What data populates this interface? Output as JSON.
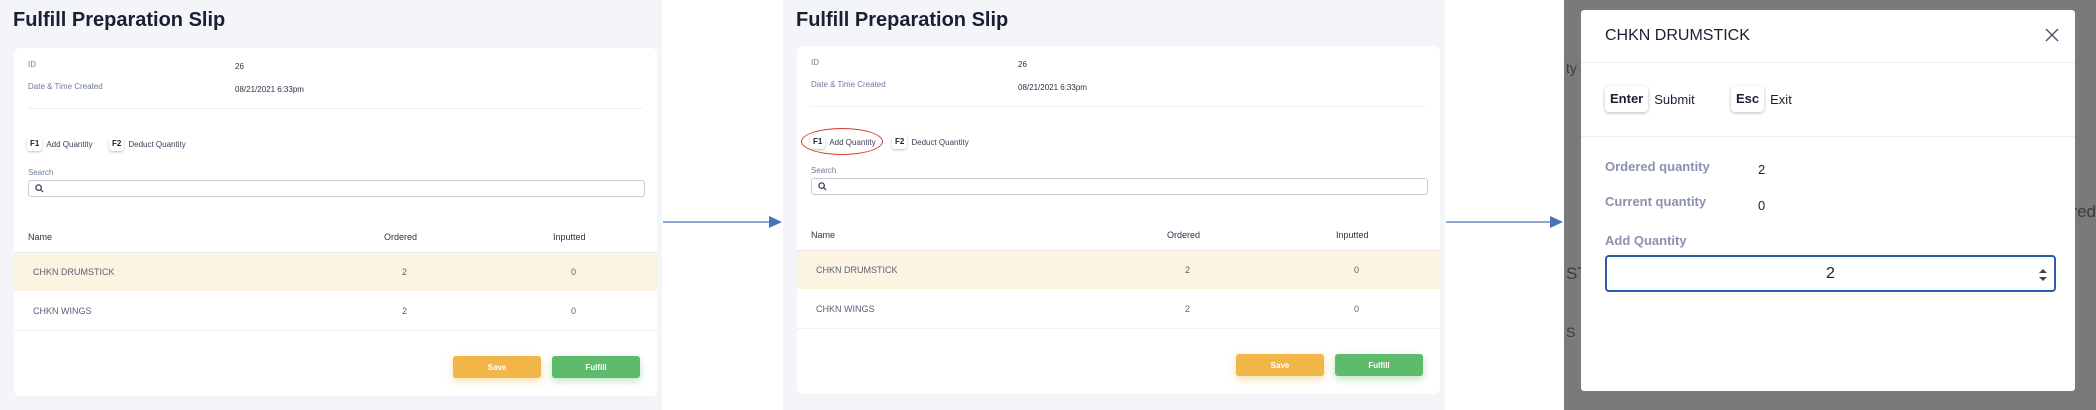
{
  "slip": {
    "title": "Fulfill Preparation Slip",
    "id_label": "ID",
    "id_value": "26",
    "created_label": "Date & Time Created",
    "created_value": "08/21/2021 6:33pm",
    "shortcut_f1_key": "F1",
    "shortcut_f1_label": "Add Quantity",
    "shortcut_f2_key": "F2",
    "shortcut_f2_label": "Deduct Quantity",
    "search_label": "Search",
    "search_value": "",
    "columns": {
      "name": "Name",
      "ordered": "Ordered",
      "inputted": "Inputted"
    },
    "rows": [
      {
        "name": "CHKN DRUMSTICK",
        "ordered": "2",
        "inputted": "0",
        "selected": true
      },
      {
        "name": "CHKN WINGS",
        "ordered": "2",
        "inputted": "0",
        "selected": false
      }
    ],
    "save_label": "Save",
    "fulfill_label": "Fulfill"
  },
  "modal": {
    "title": "CHKN DRUMSTICK",
    "enter_key": "Enter",
    "enter_label": "Submit",
    "esc_key": "Esc",
    "esc_label": "Exit",
    "ordered_label": "Ordered quantity",
    "ordered_value": "2",
    "current_label": "Current quantity",
    "current_value": "0",
    "add_label": "Add Quantity",
    "add_value": "2",
    "background_fragments": [
      "ty",
      "red",
      "ST",
      "S"
    ]
  },
  "colors": {
    "accent_save": "#f1b548",
    "accent_fulfill": "#5dbb6b",
    "selected_row": "#fdf3e1",
    "highlight_ring": "#d43b2e",
    "arrow": "#4a72b8",
    "input_focus": "#2d5ca8"
  },
  "icons": {
    "search": "search-icon",
    "close": "close-icon",
    "arrow": "arrow-right-icon",
    "spinner": "spinner-icon"
  }
}
